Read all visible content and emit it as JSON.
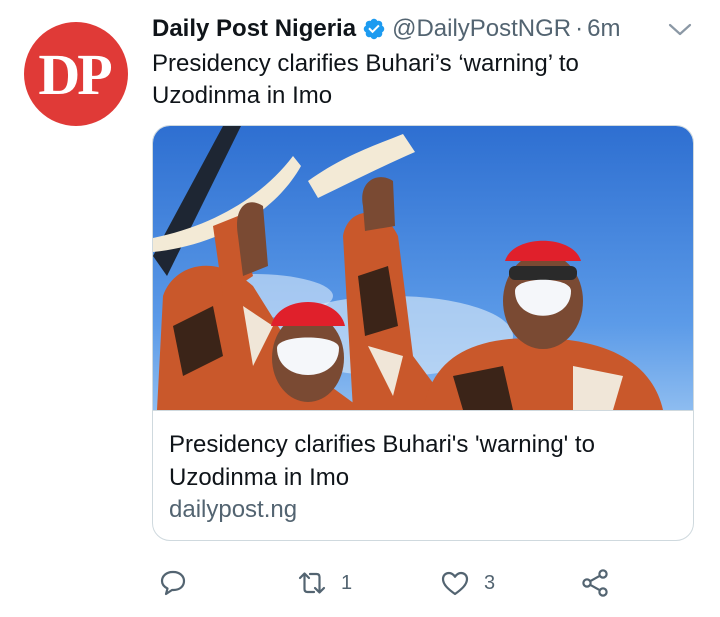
{
  "tweet": {
    "avatar_text": "DP",
    "display_name": "Daily Post Nigeria",
    "handle": "@DailyPostNGR",
    "separator": "·",
    "time": "6m",
    "text": "Presidency clarifies Buhari’s ‘warning’ to Uzodinma in Imo"
  },
  "card": {
    "title": "Presidency clarifies Buhari's 'warning' to Uzodinma in Imo",
    "domain": "dailypost.ng"
  },
  "actions": {
    "reply_icon": "reply-icon",
    "retweet_icon": "retweet-icon",
    "retweet_count": "1",
    "like_icon": "heart-icon",
    "like_count": "3",
    "share_icon": "share-icon"
  },
  "colors": {
    "avatar_bg": "#e03a37",
    "verified": "#1d9bf0",
    "secondary_text": "#536471",
    "border": "#cfd9de"
  }
}
